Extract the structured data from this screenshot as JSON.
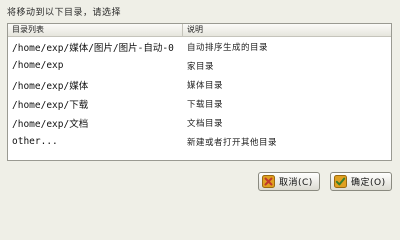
{
  "dialog": {
    "prompt": "将移动到以下目录，请选择"
  },
  "list": {
    "columns": {
      "path": "目录列表",
      "description": "说明"
    },
    "rows": [
      {
        "path": "/home/exp/媒体/图片/图片-自动-0",
        "description": "自动排序生成的目录"
      },
      {
        "path": "/home/exp",
        "description": "家目录"
      },
      {
        "path": "/home/exp/媒体",
        "description": "媒体目录"
      },
      {
        "path": "/home/exp/下载",
        "description": "下载目录"
      },
      {
        "path": "/home/exp/文档",
        "description": "文档目录"
      },
      {
        "path": "other...",
        "description": "新建或者打开其他目录"
      }
    ]
  },
  "buttons": {
    "cancel_label": "取消(C)",
    "ok_label": "确定(O)"
  },
  "icons": {
    "cancel": "cancel-x-icon",
    "ok": "ok-check-icon"
  },
  "colors": {
    "cancel_icon": "#c0392b",
    "ok_icon": "#3a7d2a",
    "icon_accent": "#e0a020"
  }
}
